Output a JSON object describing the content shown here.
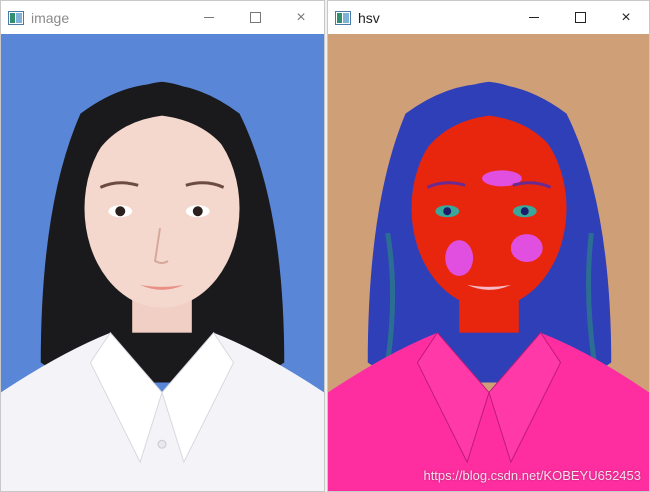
{
  "windows": {
    "left": {
      "title": "image",
      "controls": {
        "minimize": "minimize",
        "maximize": "maximize",
        "close": "close"
      }
    },
    "right": {
      "title": "hsv",
      "controls": {
        "minimize": "minimize",
        "maximize": "maximize",
        "close": "close"
      }
    }
  },
  "watermark": "https://blog.csdn.net/KOBEYU652453",
  "colors": {
    "left_background": "#5a86d8",
    "right_background": "#cf9f78",
    "hsv_skin": "#e8260e",
    "hsv_shirt": "#ff2ea0",
    "hsv_hair": "#2f3fb8"
  },
  "icons": {
    "app": "opencv-window-icon",
    "close": "×"
  }
}
